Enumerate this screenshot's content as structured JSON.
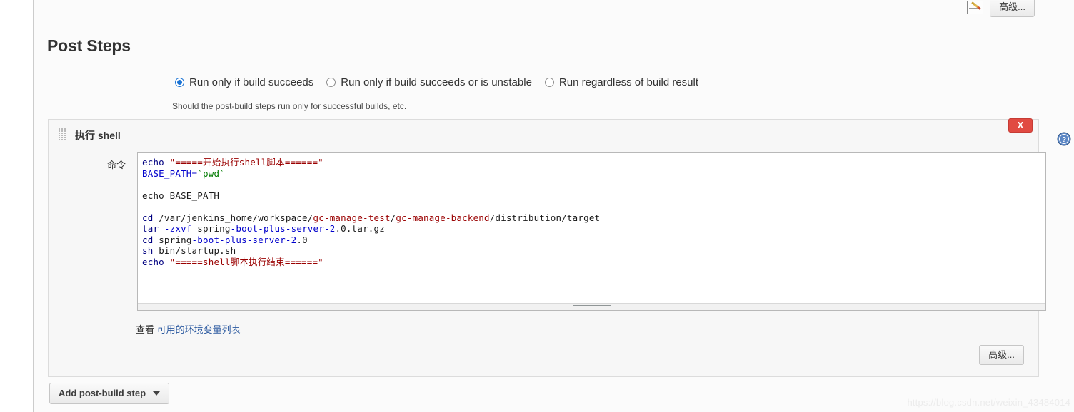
{
  "topbar": {
    "notepad_icon": "notepad-pencil-icon",
    "advanced_label": "高级..."
  },
  "section": {
    "title": "Post Steps"
  },
  "run_condition": {
    "options": [
      {
        "label": "Run only if build succeeds",
        "selected": true
      },
      {
        "label": "Run only if build succeeds or is unstable",
        "selected": false
      },
      {
        "label": "Run regardless of build result",
        "selected": false
      }
    ],
    "help_text": "Should the post-build steps run only for successful builds, etc."
  },
  "builder": {
    "title": "执行 shell",
    "drag_handle_icon": "drag-handle-icon",
    "close_label": "X",
    "help_icon": "help-question-icon",
    "command_label": "命令",
    "advanced_label": "高级...",
    "code_lines": [
      [
        {
          "t": "echo ",
          "c": "kw"
        },
        {
          "t": "\"=====开始执行shell脚本======\"",
          "c": "str"
        }
      ],
      [
        {
          "t": "BASE_PATH=",
          "c": "var"
        },
        {
          "t": "`pwd`",
          "c": "sub"
        }
      ],
      [],
      [
        {
          "t": "echo BASE_PATH",
          "c": "plain"
        }
      ],
      [],
      [
        {
          "t": "cd ",
          "c": "kw"
        },
        {
          "t": "/var/jenkins_home/workspace/",
          "c": "path"
        },
        {
          "t": "gc-manage-test",
          "c": "pathhl"
        },
        {
          "t": "/",
          "c": "path"
        },
        {
          "t": "gc-manage-backend",
          "c": "pathhl"
        },
        {
          "t": "/distribution/target",
          "c": "path"
        }
      ],
      [
        {
          "t": "tar ",
          "c": "kw"
        },
        {
          "t": "-zxvf",
          "c": "flag"
        },
        {
          "t": " spring",
          "c": "plain"
        },
        {
          "t": "-boot-plus-server-2",
          "c": "flag"
        },
        {
          "t": ".0.tar.gz",
          "c": "plain"
        }
      ],
      [
        {
          "t": "cd ",
          "c": "kw"
        },
        {
          "t": "spring",
          "c": "plain"
        },
        {
          "t": "-boot-plus-server-2",
          "c": "flag"
        },
        {
          "t": ".0",
          "c": "plain"
        }
      ],
      [
        {
          "t": "sh ",
          "c": "kw"
        },
        {
          "t": "bin/startup.sh",
          "c": "plain"
        }
      ],
      [
        {
          "t": "echo ",
          "c": "kw"
        },
        {
          "t": "\"=====shell脚本执行结束======\"",
          "c": "str"
        }
      ]
    ],
    "env_prefix": "查看",
    "env_link": "可用的环境变量列表"
  },
  "footer": {
    "add_step_label": "Add post-build step",
    "caret_icon": "chevron-down-icon"
  },
  "watermark": {
    "text": "https://blog.csdn.net/weixin_43484014"
  },
  "colors": {
    "accent_blue": "#1a73d4",
    "danger_red": "#e14a42",
    "link_blue": "#2c5aa0",
    "code_keyword": "#000080",
    "code_string": "#9a0000",
    "code_var": "#0000cc",
    "code_subshell": "#007b00"
  }
}
